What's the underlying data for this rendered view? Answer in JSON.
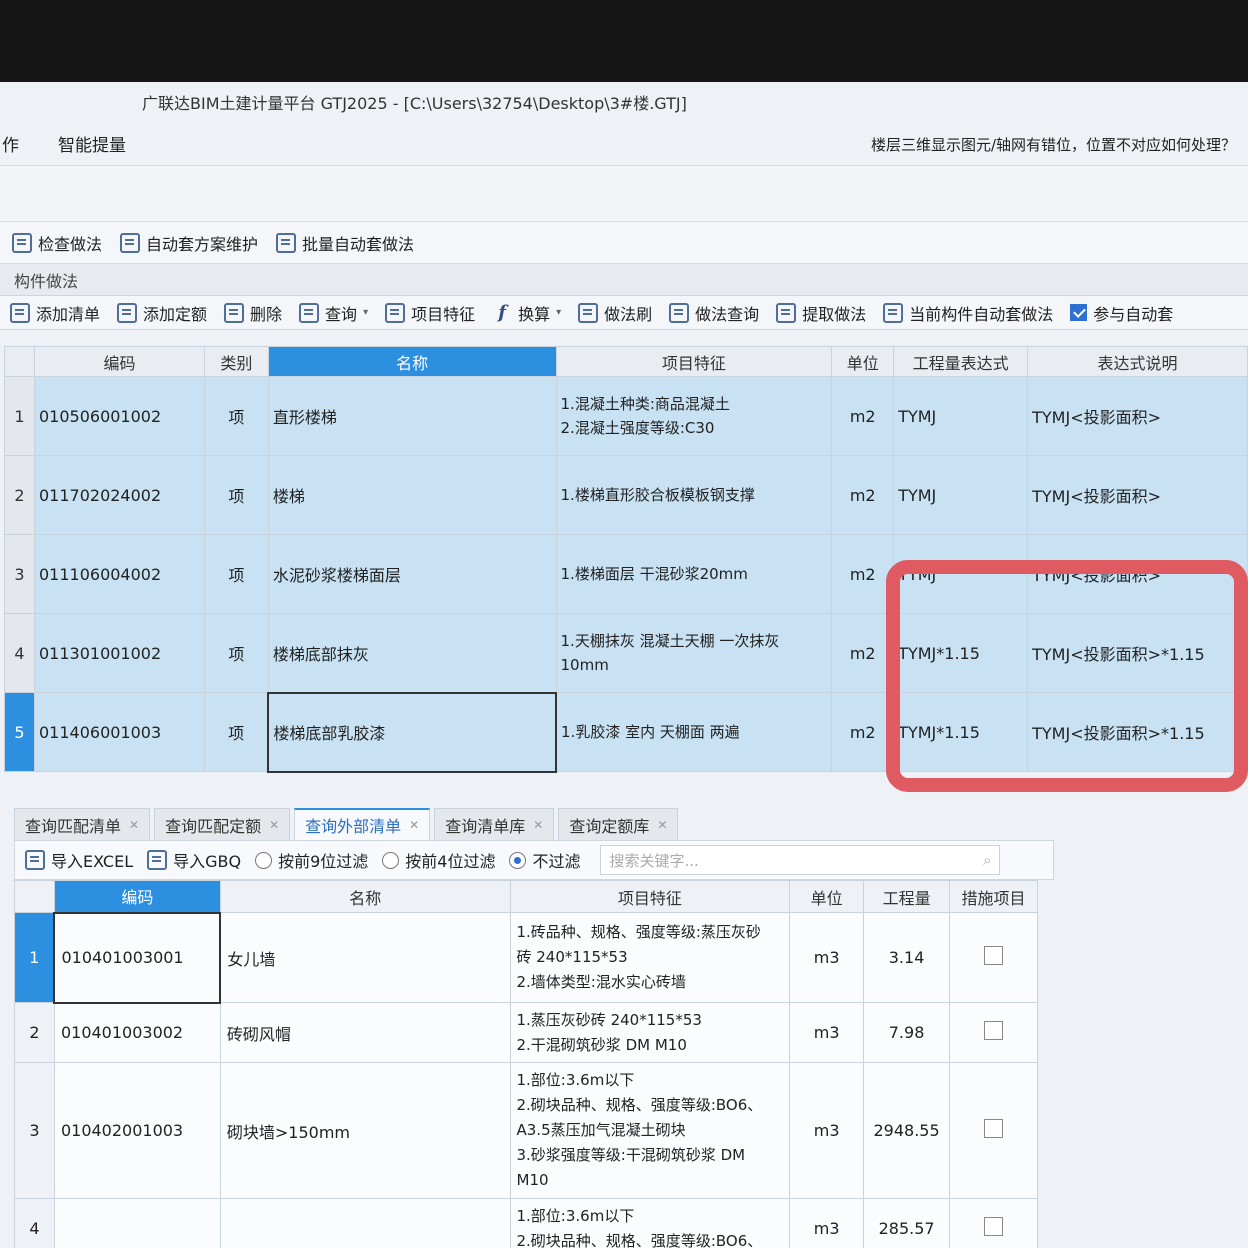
{
  "window": {
    "title": "广联达BIM土建计量平台 GTJ2025 - [C:\\Users\\32754\\Desktop\\3#楼.GTJ]"
  },
  "menu": {
    "items": [
      "作",
      "智能提量"
    ],
    "hint": "楼层三维显示图元/轴网有错位，位置不对应如何处理？"
  },
  "toolbar_top": {
    "check_method": "检查做法",
    "auto_scheme": "自动套方案维护",
    "batch_auto": "批量自动套做法"
  },
  "panel": {
    "title": "构件做法",
    "toolbar": {
      "add_list": "添加清单",
      "add_quota": "添加定额",
      "delete": "删除",
      "query": "查询",
      "item_feature": "项目特征",
      "convert": "换算",
      "method_brush": "做法刷",
      "method_query": "做法查询",
      "extract_method": "提取做法",
      "auto_apply": "当前构件自动套做法",
      "participate_auto": "参与自动套"
    },
    "columns": [
      "编码",
      "类别",
      "名称",
      "项目特征",
      "单位",
      "工程量表达式",
      "表达式说明"
    ],
    "rows": [
      {
        "n": "1",
        "code": "010506001002",
        "type": "项",
        "name": "直形楼梯",
        "feat1": "1.混凝土种类:商品混凝土",
        "feat2": "2.混凝土强度等级:C30",
        "unit": "m2",
        "expr": "TYMJ",
        "desc": "TYMJ<投影面积>"
      },
      {
        "n": "2",
        "code": "011702024002",
        "type": "项",
        "name": "楼梯",
        "feat1": "1.楼梯直形胶合板模板钢支撑",
        "feat2": "",
        "unit": "m2",
        "expr": "TYMJ",
        "desc": "TYMJ<投影面积>"
      },
      {
        "n": "3",
        "code": "011106004002",
        "type": "项",
        "name": "水泥砂浆楼梯面层",
        "feat1": "1.楼梯面层 干混砂浆20mm",
        "feat2": "",
        "unit": "m2",
        "expr": "TYMJ",
        "desc": "TYMJ<投影面积>"
      },
      {
        "n": "4",
        "code": "011301001002",
        "type": "项",
        "name": "楼梯底部抹灰",
        "feat1": "1.天棚抹灰 混凝土天棚 一次抹灰",
        "feat2": "10mm",
        "unit": "m2",
        "expr": "TYMJ*1.15",
        "desc": "TYMJ<投影面积>*1.15"
      },
      {
        "n": "5",
        "code": "011406001003",
        "type": "项",
        "name": "楼梯底部乳胶漆",
        "feat1": "1.乳胶漆 室内 天棚面 两遍",
        "feat2": "",
        "unit": "m2",
        "expr": "TYMJ*1.15",
        "desc": "TYMJ<投影面积>*1.15"
      }
    ]
  },
  "lower": {
    "tabs": [
      "查询匹配清单",
      "查询匹配定额",
      "查询外部清单",
      "查询清单库",
      "查询定额库"
    ],
    "toolbar": {
      "import_excel": "导入EXCEL",
      "import_gbq": "导入GBQ",
      "filter9": "按前9位过滤",
      "filter4": "按前4位过滤",
      "no_filter": "不过滤",
      "search_placeholder": "搜索关键字..."
    },
    "columns": [
      "编码",
      "名称",
      "项目特征",
      "单位",
      "工程量",
      "措施项目"
    ],
    "rows": [
      {
        "n": "1",
        "code": "010401003001",
        "name": "女儿墙",
        "feats": [
          "1.砖品种、规格、强度等级:蒸压灰砂",
          "砖 240*115*53",
          "2.墙体类型:混水实心砖墙"
        ],
        "unit": "m3",
        "qty": "3.14"
      },
      {
        "n": "2",
        "code": "010401003002",
        "name": "砖砌风帽",
        "feats": [
          "1.蒸压灰砂砖 240*115*53",
          "2.干混砌筑砂浆 DM M10"
        ],
        "unit": "m3",
        "qty": "7.98"
      },
      {
        "n": "3",
        "code": "010402001003",
        "name": "砌块墙>150mm",
        "feats": [
          "1.部位:3.6m以下",
          "2.砌块品种、规格、强度等级:BO6、",
          "A3.5蒸压加气混凝土砌块",
          "3.砂浆强度等级:干混砌筑砂浆 DM",
          "M10"
        ],
        "unit": "m3",
        "qty": "2948.55"
      },
      {
        "n": "4",
        "code": "",
        "name": "",
        "feats": [
          "1.部位:3.6m以下",
          "2.砌块品种、规格、强度等级:BO6、"
        ],
        "unit": "m3",
        "qty": "285.57"
      }
    ]
  },
  "colors": {
    "accent": "#2d8fe0",
    "row_bg": "#c8e2f4",
    "annotation": "#e05a62"
  }
}
